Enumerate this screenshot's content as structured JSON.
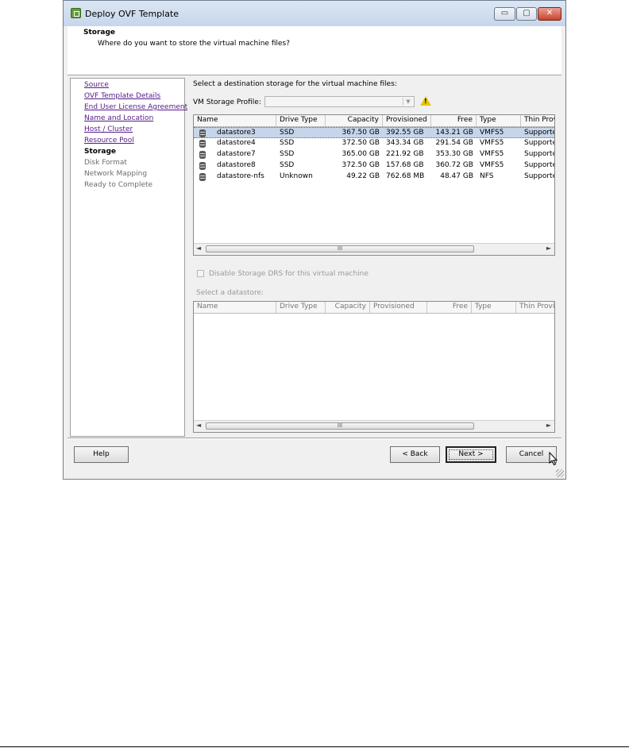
{
  "window": {
    "title": "Deploy OVF Template",
    "controls": {
      "minimize": "▭",
      "maximize": "▢",
      "close": "✕"
    }
  },
  "header": {
    "title": "Storage",
    "subtitle": "Where do you want to store the virtual machine files?"
  },
  "steps": [
    {
      "label": "Source",
      "state": "done"
    },
    {
      "label": "OVF Template Details",
      "state": "done"
    },
    {
      "label": "End User License Agreement",
      "state": "done"
    },
    {
      "label": "Name and Location",
      "state": "done"
    },
    {
      "label": "Host / Cluster",
      "state": "done"
    },
    {
      "label": "Resource Pool",
      "state": "done"
    },
    {
      "label": "Storage",
      "state": "current"
    },
    {
      "label": "Disk Format",
      "state": "pending"
    },
    {
      "label": "Network Mapping",
      "state": "pending"
    },
    {
      "label": "Ready to Complete",
      "state": "pending"
    }
  ],
  "main": {
    "prompt": "Select a destination storage for the virtual machine files:",
    "vm_profile_label": "VM Storage Profile:",
    "vm_profile_value": "",
    "columns": [
      "Name",
      "Drive Type",
      "Capacity",
      "Provisioned",
      "Free",
      "Type",
      "Thin Prov"
    ],
    "rows": [
      [
        "datastore3",
        "SSD",
        "367.50 GB",
        "392.55 GB",
        "143.21 GB",
        "VMFS5",
        "Supporte"
      ],
      [
        "datastore4",
        "SSD",
        "372.50 GB",
        "343.34 GB",
        "291.54 GB",
        "VMFS5",
        "Supporte"
      ],
      [
        "datastore7",
        "SSD",
        "365.00 GB",
        "221.92 GB",
        "353.30 GB",
        "VMFS5",
        "Supporte"
      ],
      [
        "datastore8",
        "SSD",
        "372.50 GB",
        "157.68 GB",
        "360.72 GB",
        "VMFS5",
        "Supporte"
      ],
      [
        "datastore-nfs",
        "Unknown",
        "49.22 GB",
        "762.68 MB",
        "48.47 GB",
        "NFS",
        "Supporte"
      ]
    ],
    "selected_row": 0,
    "scroll_thumb_label": "III",
    "disable_drs_label": "Disable Storage DRS for this virtual machine",
    "select_datastore_label": "Select a datastore:",
    "lower_columns": [
      "Name",
      "Drive Type",
      "Capacity",
      "Provisioned",
      "Free",
      "Type",
      "Thin Provi"
    ]
  },
  "buttons": {
    "help": "Help",
    "back": "< Back",
    "next": "Next >",
    "cancel": "Cancel"
  }
}
